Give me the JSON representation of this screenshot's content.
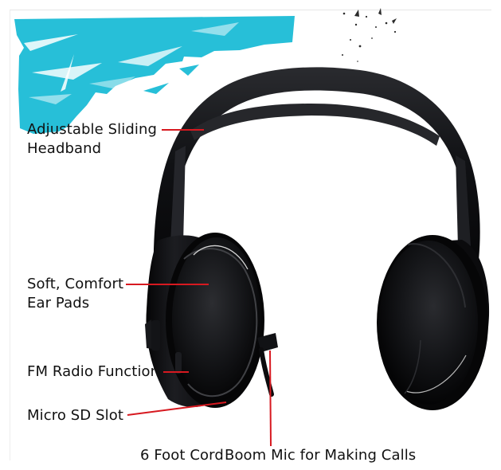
{
  "product_image": {
    "accent_color": "#27bfd8",
    "headphone_color": "#111111",
    "annotation_line_color": "#d71920"
  },
  "labels": {
    "headband_line1": "Adjustable Sliding",
    "headband_line2": "Headband",
    "earpads_line1": "Soft, Comfort",
    "earpads_line2": "Ear Pads",
    "fm_radio": "FM Radio Function",
    "micro_sd": "Micro SD Slot",
    "cord": "6 Foot Cord",
    "boom_mic": "Boom Mic for Making Calls"
  }
}
